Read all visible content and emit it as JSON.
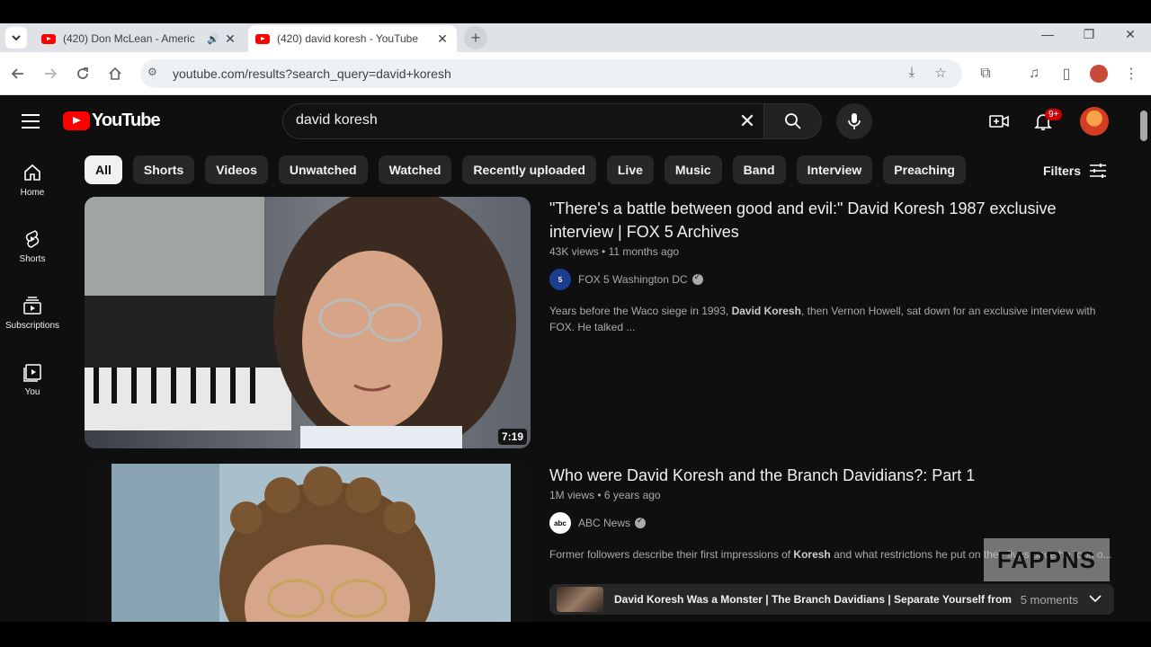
{
  "browser": {
    "tabs": [
      {
        "title": "(420) Don McLean - Americ",
        "audio": true
      },
      {
        "title": "(420) david koresh - YouTube",
        "active": true
      }
    ],
    "url": "youtube.com/results?search_query=david+koresh"
  },
  "youtube": {
    "logo_text": "YouTube",
    "search_query": "david koresh",
    "notifications_badge": "9+",
    "sidebar": [
      {
        "label": "Home",
        "icon": "home-icon"
      },
      {
        "label": "Shorts",
        "icon": "shorts-icon"
      },
      {
        "label": "Subscriptions",
        "icon": "subscriptions-icon"
      },
      {
        "label": "You",
        "icon": "you-icon"
      }
    ],
    "chips": [
      "All",
      "Shorts",
      "Videos",
      "Unwatched",
      "Watched",
      "Recently uploaded",
      "Live",
      "Music",
      "Band",
      "Interview",
      "Preaching"
    ],
    "filters_label": "Filters",
    "results": [
      {
        "title": "\"There's a battle between good and evil:\" David Koresh 1987 exclusive interview | FOX 5 Archives",
        "views": "43K views",
        "age": "11 months ago",
        "duration": "7:19",
        "channel": "FOX 5 Washington DC",
        "description_before": "Years before the Waco siege in 1993, ",
        "description_bold": "David Koresh",
        "description_after": ", then Vernon Howell, sat down for an exclusive interview with FOX. He talked ..."
      },
      {
        "title": "Who were David Koresh and the Branch Davidians?: Part 1",
        "views": "1M views",
        "age": "6 years ago",
        "channel": "ABC News",
        "description_before": "Former followers describe their first impressions of ",
        "description_bold": "Koresh",
        "description_after": " and what restrictions he put on their lives once he took o...",
        "moments_title": "David Koresh Was a Monster | The Branch Davidians | Separate Yourself from the...",
        "moments_count": "5 moments"
      }
    ],
    "watermark": "FAPPNS"
  }
}
